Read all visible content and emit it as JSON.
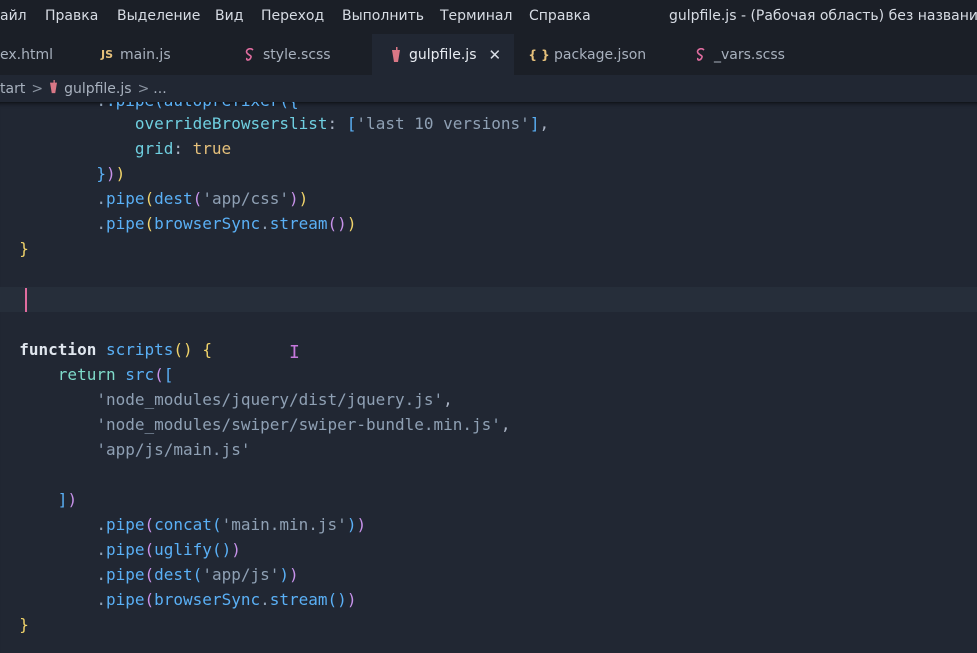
{
  "menu": {
    "items": [
      "айл",
      "Правка",
      "Выделение",
      "Вид",
      "Переход",
      "Выполнить",
      "Терминал",
      "Справка"
    ],
    "window_title": "gulpfile.js - (Рабочая область) без названия - V"
  },
  "tabs": [
    {
      "label": "ex.html",
      "icon": "html-icon"
    },
    {
      "label": "main.js",
      "icon": "js-icon",
      "icon_text": "JS"
    },
    {
      "label": "style.scss",
      "icon": "sass-icon"
    },
    {
      "label": "gulpfile.js",
      "icon": "gulp-icon",
      "active": true
    },
    {
      "label": "package.json",
      "icon": "json-icon",
      "icon_text": "{ }"
    },
    {
      "label": "_vars.scss",
      "icon": "sass-icon"
    }
  ],
  "tab_close_glyph": "✕",
  "breadcrumb": {
    "items": [
      "tart",
      "gulpfile.js",
      "..."
    ],
    "separator": ">"
  },
  "code": {
    "top_fragment": ".pipe(autoprefixer({",
    "lines": [
      "overrideBrowserslist: ['last 10 versions'],",
      "grid: true",
      "}))",
      ".pipe(dest('app/css'))",
      ".pipe(browserSync.stream())",
      "}",
      "",
      "",
      "function scripts() {",
      "return src([",
      "'node_modules/jquery/dist/jquery.js',",
      "'node_modules/swiper/swiper-bundle.min.js',",
      "'app/js/main.js'",
      "",
      "])",
      ".pipe(concat('main.min.js'))",
      ".pipe(uglify())",
      ".pipe(dest('app/js'))",
      ".pipe(browserSync.stream())",
      "}"
    ]
  },
  "tokens": {
    "pipe": "pipe",
    "overrideBrowserslist": "overrideBrowserslist",
    "last10": "'last 10 versions'",
    "grid": "grid",
    "true": "true",
    "dest": "dest",
    "app_css": "'app/css'",
    "browserSync": "browserSync",
    "stream": "stream",
    "function": "function",
    "scripts": "scripts",
    "return": "return",
    "src": "src",
    "jquery": "'node_modules/jquery/dist/jquery.js'",
    "swiper": "'node_modules/swiper/swiper-bundle.min.js'",
    "mainjs": "'app/js/main.js'",
    "concat": "concat",
    "mainmin": "'main.min.js'",
    "uglify": "uglify",
    "app_js": "'app/js'"
  },
  "colors": {
    "editor_bg": "#212733",
    "chrome_bg": "#1b1f27",
    "cursor": "#e06c9f",
    "function_name": "#5ab0f6",
    "string": "#8fa0b4"
  }
}
